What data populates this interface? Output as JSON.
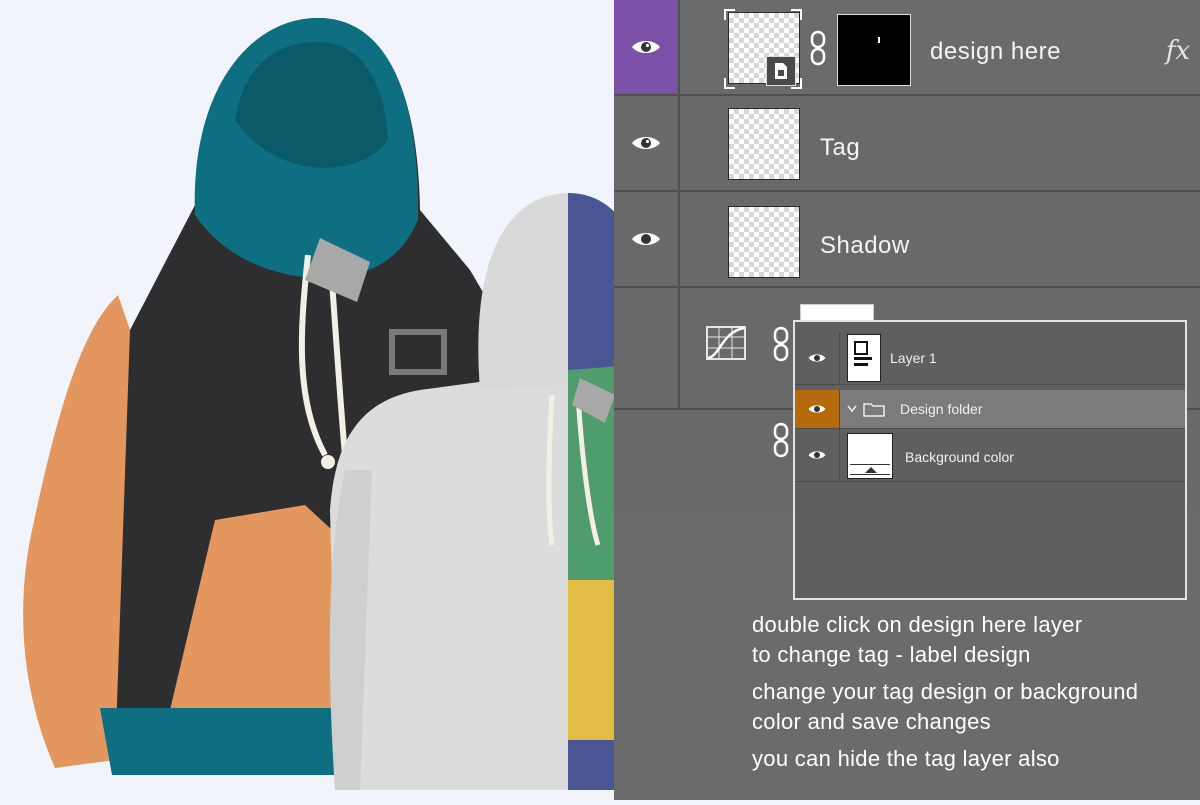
{
  "layers": [
    {
      "name": "design here",
      "fx": "fx",
      "selected": true
    },
    {
      "name": "Tag"
    },
    {
      "name": "Shadow"
    }
  ],
  "popup": {
    "rows": [
      {
        "name": "Layer 1"
      },
      {
        "name": "Design folder"
      },
      {
        "name": "Background color"
      }
    ]
  },
  "instructions": [
    "double click on design here layer",
    "to change tag - label design",
    "change your tag design or background",
    "color and save changes",
    "you can hide the tag layer also"
  ],
  "colors": {
    "panel_bg": "#6b6b6b",
    "selected_eye_bg": "#7a51a6",
    "folder_eye_bg": "#b46a0d",
    "teal": "#0f6f82",
    "charcoal": "#2e2e30",
    "orange": "#e3975f",
    "navy": "#4a5594",
    "green": "#4f9c6c",
    "yellow": "#e3bd45",
    "light_gray": "#dcdcdc"
  },
  "icons": {
    "visibility": "eye-icon",
    "link": "chain-link-icon",
    "curves": "curves-adjustment-icon",
    "folder": "folder-icon",
    "disclosure": "chevron-down-icon",
    "smart_object": "smart-object-badge-icon"
  }
}
